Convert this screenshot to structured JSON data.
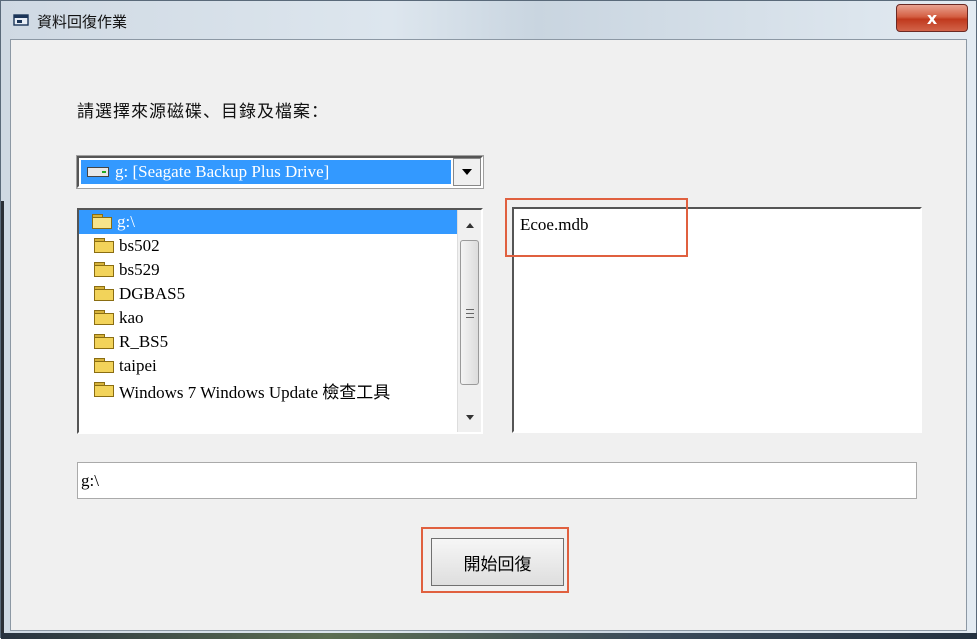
{
  "window": {
    "title": "資料回復作業",
    "close_label": "x"
  },
  "prompt": {
    "label": "請選擇來源磁碟、目錄及檔案："
  },
  "drive": {
    "selected": "g: [Seagate Backup Plus Drive]"
  },
  "directories": {
    "items": [
      {
        "label": "g:\\",
        "selected": true,
        "root": true
      },
      {
        "label": "bs502"
      },
      {
        "label": "bs529"
      },
      {
        "label": "DGBAS5"
      },
      {
        "label": "kao"
      },
      {
        "label": "R_BS5"
      },
      {
        "label": "taipei"
      },
      {
        "label": "Windows 7 Windows Update 檢查工具"
      }
    ]
  },
  "files": {
    "items": [
      "Ecoe.mdb"
    ]
  },
  "path": {
    "value": "g:\\"
  },
  "actions": {
    "start_label": "開始回復"
  },
  "colors": {
    "selection": "#3399ff",
    "highlight": "#e0603f",
    "dialog_bg": "#f0f0f0"
  }
}
